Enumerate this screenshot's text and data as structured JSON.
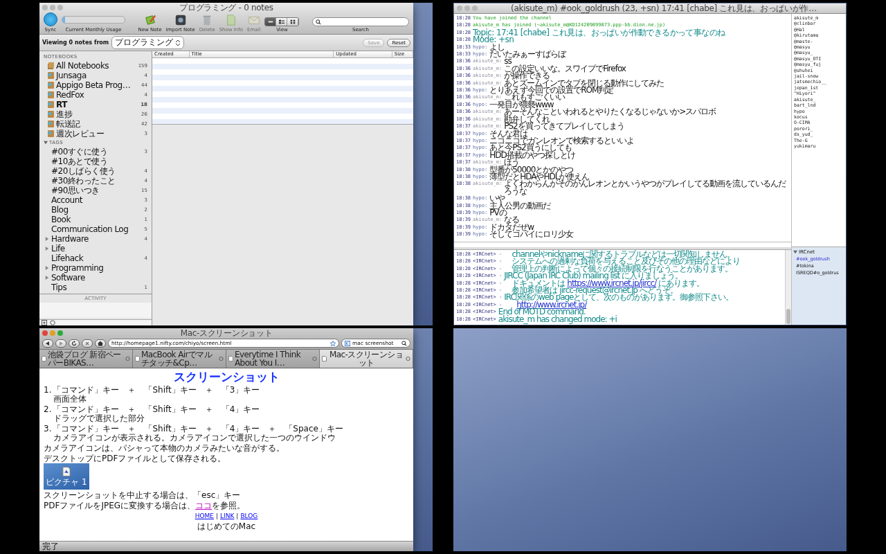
{
  "notes_window": {
    "title": "プログラミング - 0 notes",
    "active": false,
    "toolbar": {
      "sync_label": "Sync",
      "usage_label": "Current Monthly Usage",
      "usage_bar": {
        "level": 0.04
      },
      "actions": [
        {
          "label": "New Note",
          "kind": "new",
          "disabled": false
        },
        {
          "label": "Import Note",
          "kind": "import",
          "disabled": false
        },
        {
          "label": "Delete",
          "kind": "delete",
          "disabled": true
        },
        {
          "label": "Show Info",
          "kind": "info",
          "disabled": true
        },
        {
          "label": "Email",
          "kind": "email",
          "disabled": true
        }
      ],
      "view_label": "View",
      "view_modes": [
        {
          "kind": "list",
          "selected": true
        },
        {
          "kind": "snippet",
          "selected": false
        },
        {
          "kind": "thumb",
          "selected": false
        }
      ],
      "search_label": "Search"
    },
    "filter": {
      "label": "Viewing 0 notes from",
      "notebook": "プログラミング",
      "buttons": [
        {
          "label": "Save",
          "disabled": true
        },
        {
          "label": "Reset",
          "disabled": false
        }
      ]
    },
    "columns": [
      "Created",
      "Title",
      "Updated",
      "Size"
    ],
    "sidebar": {
      "notebooks_header": "NOTEBOOKS",
      "notebooks": [
        {
          "name": "All Notebooks",
          "count": "159",
          "kind": "all",
          "bold": false
        },
        {
          "name": "Junsaga",
          "count": "4",
          "kind": "notebook",
          "bold": false
        },
        {
          "name": "Appigo Beta Prog…",
          "count": "44",
          "kind": "notebook",
          "bold": false
        },
        {
          "name": "RedFox",
          "count": "4",
          "kind": "notebook",
          "bold": false
        },
        {
          "name": "RT",
          "count": "18",
          "kind": "notebook",
          "bold": true
        },
        {
          "name": "進捗",
          "count": "26",
          "kind": "notebook",
          "bold": false
        },
        {
          "name": "転送記",
          "count": "42",
          "kind": "notebook",
          "bold": false
        },
        {
          "name": "週次レビュー",
          "count": "3",
          "kind": "notebook",
          "bold": false
        }
      ],
      "tags_header": "TAGS",
      "tags_expanded": true,
      "tags": [
        {
          "name": "#00すぐに使う",
          "count": "3",
          "kind": "tag"
        },
        {
          "name": "#10あとで使う",
          "kind": "tag"
        },
        {
          "name": "#20しばらく使う",
          "count": "4",
          "kind": "tag"
        },
        {
          "name": "#30終わったこと",
          "count": "4",
          "kind": "tag"
        },
        {
          "name": "#90思いつき",
          "count": "15",
          "kind": "tag"
        },
        {
          "name": "Account",
          "count": "3",
          "kind": "tag"
        },
        {
          "name": "Blog",
          "count": "2",
          "kind": "tag"
        },
        {
          "name": "Book",
          "count": "1",
          "kind": "tag"
        },
        {
          "name": "Communication Log",
          "count": "5",
          "kind": "tag"
        },
        {
          "name": "Hardware",
          "count": "4",
          "kind": "group",
          "expanded": false
        },
        {
          "name": "Life",
          "kind": "group",
          "expanded": false
        },
        {
          "name": "Lifehack",
          "count": "4",
          "kind": "tag"
        },
        {
          "name": "Programming",
          "kind": "group",
          "expanded": false
        },
        {
          "name": "Software",
          "kind": "group",
          "expanded": false
        },
        {
          "name": "Tips",
          "count": "1",
          "kind": "tag"
        }
      ],
      "activity_label": "ACTIVITY"
    }
  },
  "chat_window": {
    "title": "(akisute_m) #ook_goldrush (23, +sn) 17:41 [chabe] これ見は、おっぱいが作…",
    "active": false,
    "messages": [
      {
        "time": "18:28",
        "kind": "system",
        "text": "You have joined the channel"
      },
      {
        "time": "18:28",
        "kind": "system",
        "text": "akisute_m has joined (~akisute_m@KD124209099073.ppp-bb.dion.ne.jp)"
      },
      {
        "time": "18:28",
        "kind": "topic",
        "text": "Topic: 17:41 [chabe] これ見は、おっぱいが作動できるかって事なのね"
      },
      {
        "time": "18:28",
        "kind": "topic",
        "text": "Mode: +sn"
      },
      {
        "time": "18:33",
        "kind": "message",
        "nick": "hypo:",
        "self": false,
        "text": "よし"
      },
      {
        "time": "18:33",
        "kind": "message",
        "nick": "hypo:",
        "self": false,
        "text": "だいたみぁーすばらぼ"
      },
      {
        "time": "18:36",
        "kind": "message",
        "nick": "akisute_m:",
        "self": true,
        "text": "ss"
      },
      {
        "time": "18:36",
        "kind": "message",
        "nick": "akisute_m:",
        "self": true,
        "text": "この設定いいな。スワイプでFirefox"
      },
      {
        "time": "18:36",
        "kind": "message",
        "nick": "akisute_m:",
        "self": true,
        "text": "が操作できる"
      },
      {
        "time": "18:36",
        "kind": "message",
        "nick": "akisute_m:",
        "self": true,
        "text": "あとズームインでタブを閉じる動作にしてみた"
      },
      {
        "time": "18:36",
        "kind": "message",
        "nick": "hypo:",
        "self": false,
        "text": "とりあえず今回での設置でROM判定"
      },
      {
        "time": "18:36",
        "kind": "message",
        "nick": "akisute_m:",
        "self": true,
        "text": "これもすごくいい"
      },
      {
        "time": "18:36",
        "kind": "message",
        "nick": "hypo:",
        "self": false,
        "text": "一発目が猥褻www"
      },
      {
        "time": "18:36",
        "kind": "message",
        "nick": "akisute_m:",
        "self": true,
        "text": "あーそんなこといわれるとやりたくなるじゃないか>スパロボ"
      },
      {
        "time": "18:36",
        "kind": "message",
        "nick": "akisute_m:",
        "self": true,
        "text": "勘弁してくれ"
      },
      {
        "time": "18:37",
        "kind": "message",
        "nick": "akisute_m:",
        "self": true,
        "text": "PS2を買ってきてプレイしてしまう"
      },
      {
        "time": "18:37",
        "kind": "message",
        "nick": "hypo:",
        "self": false,
        "text": "そんな君は"
      },
      {
        "time": "18:37",
        "kind": "message",
        "nick": "hypo:",
        "self": false,
        "text": "ニコニコでガンレオンで検索するといいよ"
      },
      {
        "time": "18:37",
        "kind": "message",
        "nick": "hypo:",
        "self": false,
        "text": "あと今PS2買うにしても"
      },
      {
        "time": "18:37",
        "kind": "message",
        "nick": "hypo:",
        "self": false,
        "text": "HDD搭載のやつ探しとけ"
      },
      {
        "time": "18:37",
        "kind": "message",
        "nick": "akisute_m:",
        "self": true,
        "text": "ほう"
      },
      {
        "time": "18:38",
        "kind": "message",
        "nick": "hypo:",
        "self": false,
        "text": "型番が50000とかのやつ"
      },
      {
        "time": "18:38",
        "kind": "message",
        "nick": "hypo:",
        "self": false,
        "text": "薄型だとHDAやHDLが使えん"
      },
      {
        "time": "18:38",
        "kind": "message",
        "nick": "akisute_m:",
        "self": true,
        "text": "よくわからんがそのがんレオンとかいうやつがプレイしてる動画を流しているんだろうな"
      },
      {
        "time": "18:38",
        "kind": "message",
        "nick": "hypo:",
        "self": false,
        "text": "いや"
      },
      {
        "time": "18:38",
        "kind": "message",
        "nick": "hypo:",
        "self": false,
        "text": "主人公男の動画だ"
      },
      {
        "time": "18:39",
        "kind": "message",
        "nick": "hypo:",
        "self": false,
        "text": "PVの"
      },
      {
        "time": "18:39",
        "kind": "message",
        "nick": "akisute_m:",
        "self": true,
        "text": "なる"
      },
      {
        "time": "18:39",
        "kind": "message",
        "nick": "hypo:",
        "self": false,
        "text": "ドカタだぜw"
      },
      {
        "time": "18:39",
        "kind": "message",
        "nick": "hypo:",
        "self": false,
        "text": "そしてコバイにロリ少女"
      }
    ],
    "server_messages": [
      {
        "time": "18:28",
        "source": "<IRCnet> -",
        "text": "    channelやnicknameに関するトラブルなどは一切関知しません。"
      },
      {
        "time": "18:28",
        "source": "<IRCnet> -",
        "text": "    システムへの過剰な負荷を与えること及びその他の理由などにより"
      },
      {
        "time": "18:28",
        "source": "<IRCnet> -",
        "text": "    管理上の判断によって個々の接続制限を行なうことがあります。"
      },
      {
        "time": "18:28",
        "source": "<IRCnet> -",
        "text": "JIRCC (Japan IRC Club) mailing list に入りましょう。"
      },
      {
        "time": "18:28",
        "source": "<IRCnet> -",
        "text": "    ドキュメントは ",
        "link": "https://www.ircnet.jp/jircc/",
        "after": " にあります。"
      },
      {
        "time": "18:28",
        "source": "<IRCnet> -",
        "text": "    参加希望者は jircc-request@ircnet.jp へどうぞ。"
      },
      {
        "time": "18:28",
        "source": "<IRCnet> -",
        "text": "IRC関係のweb pageとして、次のものがあります。御参照下さい。"
      },
      {
        "time": "18:28",
        "source": "<IRCnet> -",
        "link": "http://www.ircnet.jp/"
      },
      {
        "time": "18:28",
        "source": "<IRCnet>",
        "text": "End of MOTD command."
      },
      {
        "time": "18:28",
        "source": "<IRCnet>",
        "text": "akisute_m has changed mode: +i"
      }
    ],
    "users": [
      "akisute_m",
      "@clinbor",
      "@Hal",
      "@kirutama",
      "@maste-",
      "@masyu",
      "@masyu_",
      "@masyu_OTI",
      "@masyu_fuj",
      "@shuhei",
      "jail-snow",
      "jatsmechio__",
      "jepan_1st",
      "^Hiyori^",
      "akisute_",
      "bart_lnd",
      "hypo",
      "kocus",
      "O-CIMA",
      "porori_",
      "ds_yud_",
      "The-G",
      "yukimaru"
    ],
    "servers": [
      {
        "name": "IRCnet",
        "expanded": true,
        "children": [
          {
            "name": "#ook_goldrush",
            "selected": true
          },
          {
            "name": "#tokina",
            "selected": false
          },
          {
            "name": "ISREQD#o_goldrus",
            "selected": false
          }
        ]
      }
    ]
  },
  "browser_window": {
    "title": "Mac-スクリーンショット",
    "active": true,
    "url": "http://homepage1.nifty.com/chiyo/screen.html",
    "search": "mac screenshot",
    "tabs": [
      {
        "label": "池袋ブログ 新宿ペーパーBIKAS…",
        "selected": false
      },
      {
        "label": "MacBook Airでマルチタッチ&Cp…",
        "selected": false
      },
      {
        "label": "Everytime I Think About You I…",
        "selected": false
      },
      {
        "label": "Mac-スクリーンショット",
        "selected": true
      }
    ],
    "page": {
      "heading": "スクリーンショット",
      "steps": [
        {
          "number": "1.",
          "keys": "「コマンド」キー　＋　「Shift」キー　＋　「3」キー",
          "result": "画面全体"
        },
        {
          "number": "2.",
          "keys": "「コマンド」キー　＋　「Shift」キー　＋　「4」キー",
          "result": "ドラッグで選択した部分"
        },
        {
          "number": "3.",
          "keys": "「コマンド」キー　＋　「Shift」キー　＋　「4」キー　＋　「Space」キー",
          "result": "カメラアイコンが表示される。カメラアイコンで選択した一つのウインドウ"
        }
      ],
      "camera_note": "カメラアイコンは、パシャって本物のカメラみたいな音がする。",
      "save_note": "デスクトップにPDFファイルとして保存される。",
      "image_caption": "ピクチャ 1",
      "cancel_note": "スクリーンショットを中止する場合は、「esc」キー",
      "convert_note": {
        "before": "PDFファイルをJPEGに変換する場合は、",
        "link": "ココ",
        "after": "を参照。"
      },
      "footer_nav": [
        {
          "kind": "link",
          "text": "HOME"
        },
        {
          "kind": "separator",
          "text": "|"
        },
        {
          "kind": "link",
          "text": "LINK"
        },
        {
          "kind": "separator",
          "text": "|"
        },
        {
          "kind": "link",
          "text": "BLOG"
        }
      ],
      "footer": "はじめてのMac"
    },
    "status": "完了"
  }
}
